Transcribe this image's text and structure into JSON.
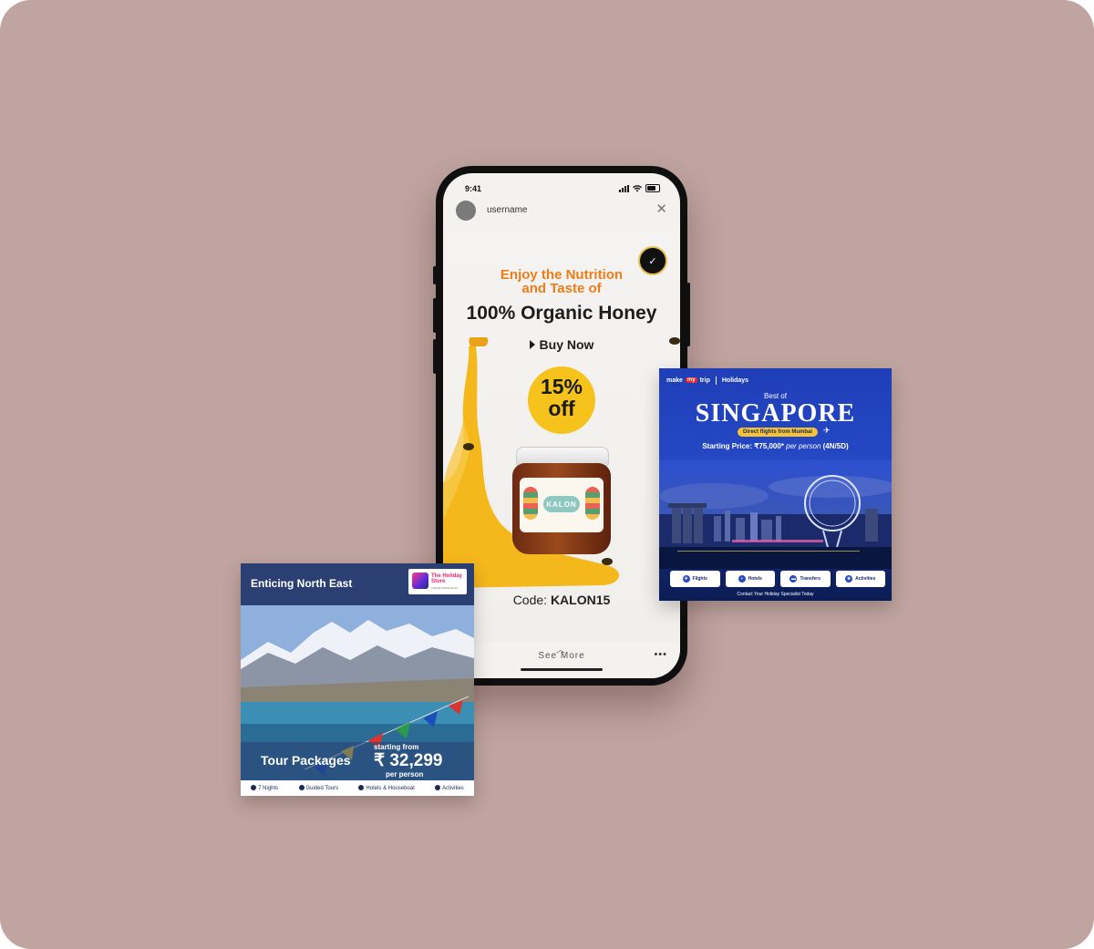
{
  "phone": {
    "status_time": "9:41",
    "username": "username",
    "close_glyph": "✕",
    "ad": {
      "headline_line1": "Enjoy the Nutrition",
      "headline_line2": "and Taste of",
      "headline_main": "100% Organic Honey",
      "cta": "Buy Now",
      "discount_pct": "15%",
      "discount_off": "off",
      "jar_brand": "KALON",
      "code_label": "Code:",
      "code_value": "KALON15"
    },
    "see_more": "See More",
    "more_dots": "•••"
  },
  "singapore_card": {
    "brand_make": "make",
    "brand_my": "my",
    "brand_trip": "trip",
    "brand_section": "Holidays",
    "best_of": "Best of",
    "title": "SINGAPORE",
    "pill": "Direct flights from Mumbai",
    "price_prefix": "Starting Price: ₹75,000*",
    "price_suffix": "per person",
    "price_duration": "(4N/5D)",
    "tiles": [
      "Flights",
      "Hotels",
      "Transfers",
      "Activities"
    ],
    "contact": "Contact Your Holiday Specialist Today",
    "colors": {
      "bg": "#2547c3",
      "pill": "#f6c432"
    }
  },
  "northeast_card": {
    "heading": "Enticing North East",
    "logo_line1": "The Holiday",
    "logo_line2": "Store",
    "logo_sub": "TRAVEL MADE EASY",
    "tour": "Tour Packages",
    "starting_from": "starting from",
    "amount": "₹ 32,299",
    "per_person": "per person",
    "features": [
      "7 Nights",
      "Guided Tours",
      "Hotels & Houseboat",
      "Activities"
    ],
    "colors": {
      "bg": "#2c3f73"
    }
  },
  "colors": {
    "backdrop": "#bfa49f",
    "honey": "#f5b81c",
    "accent_orange": "#ef7d17"
  }
}
